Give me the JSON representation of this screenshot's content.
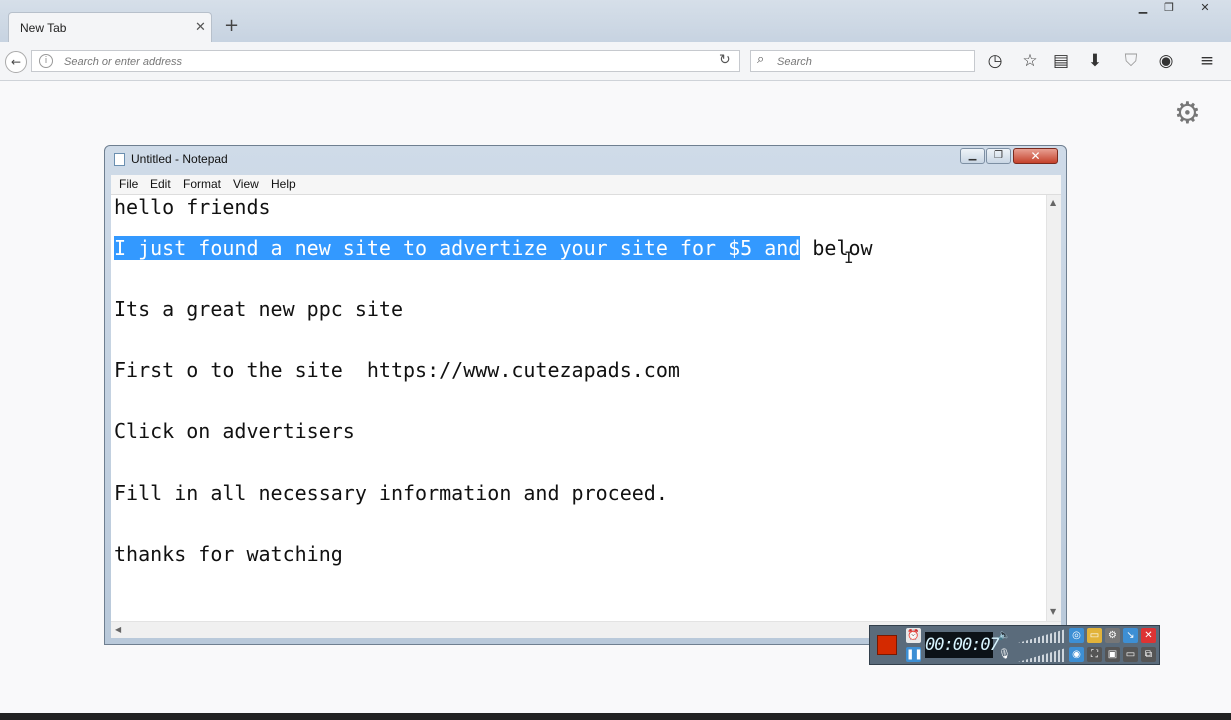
{
  "browser": {
    "tab_title": "New Tab",
    "url_placeholder": "Search or enter address",
    "search_placeholder": "Search"
  },
  "notepad": {
    "title": "Untitled - Notepad",
    "menu": [
      "File",
      "Edit",
      "Format",
      "View",
      "Help"
    ],
    "lines": [
      {
        "text": "hello friends"
      },
      {
        "selected": "I just found a new site to advertize your site for $5 and",
        "rest": " below"
      },
      {
        "text": "Its a great new ppc site"
      },
      {
        "text": "First o to the site  https://www.cutezapads.com"
      },
      {
        "text": "Click on advertisers"
      },
      {
        "text": "Fill in all necessary information and proceed."
      },
      {
        "text": "thanks for watching"
      }
    ]
  },
  "recorder": {
    "timer": "00:00:07"
  }
}
